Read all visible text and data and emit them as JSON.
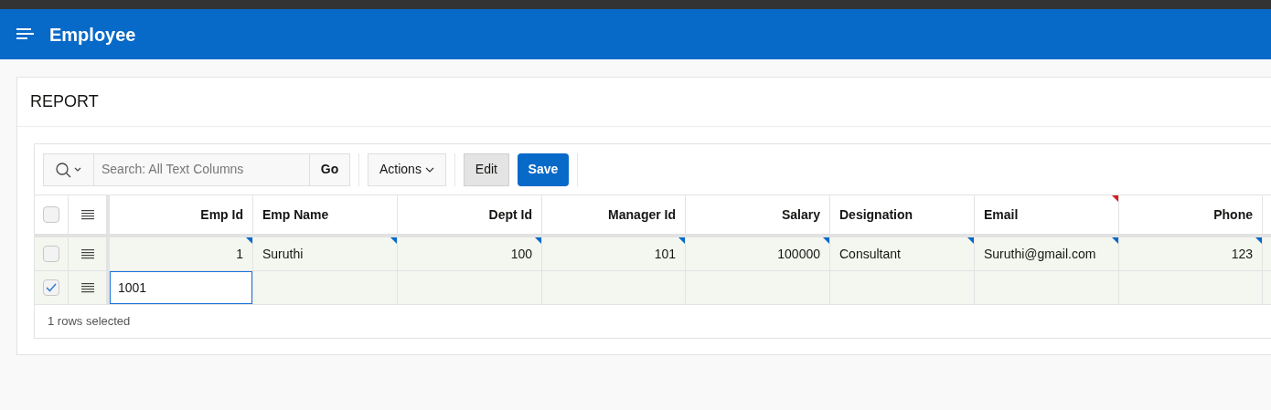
{
  "header": {
    "title": "Employee"
  },
  "region": {
    "title": "REPORT"
  },
  "toolbar": {
    "search_placeholder": "Search: All Text Columns",
    "go": "Go",
    "actions": "Actions",
    "edit": {
      "label": "Edit",
      "selected": true
    },
    "save": "Save"
  },
  "select_all": {
    "checked": false
  },
  "columns": [
    {
      "label": "Emp Id",
      "kind": "number",
      "flagged": false
    },
    {
      "label": "Emp Name",
      "kind": "text",
      "flagged": false
    },
    {
      "label": "Dept Id",
      "kind": "number",
      "flagged": false
    },
    {
      "label": "Manager Id",
      "kind": "number",
      "flagged": false
    },
    {
      "label": "Salary",
      "kind": "number",
      "flagged": false
    },
    {
      "label": "Designation",
      "kind": "text",
      "flagged": false
    },
    {
      "label": "Email",
      "kind": "text",
      "flagged": true
    },
    {
      "label": "Phone",
      "kind": "number",
      "flagged": false
    }
  ],
  "rows": [
    {
      "selected": false,
      "cells": [
        {
          "text": "1",
          "changed": true,
          "editing": false
        },
        {
          "text": "Suruthi",
          "changed": true,
          "editing": false
        },
        {
          "text": "100",
          "changed": true,
          "editing": false
        },
        {
          "text": "101",
          "changed": true,
          "editing": false
        },
        {
          "text": "100000",
          "changed": true,
          "editing": false
        },
        {
          "text": "Consultant",
          "changed": true,
          "editing": false
        },
        {
          "text": "Suruthi@gmail.com",
          "changed": true,
          "editing": false
        },
        {
          "text": "123",
          "changed": true,
          "editing": false
        }
      ]
    },
    {
      "selected": true,
      "cells": [
        {
          "text": "1001",
          "changed": false,
          "editing": true
        }
      ]
    }
  ],
  "footer": "1 rows selected"
}
